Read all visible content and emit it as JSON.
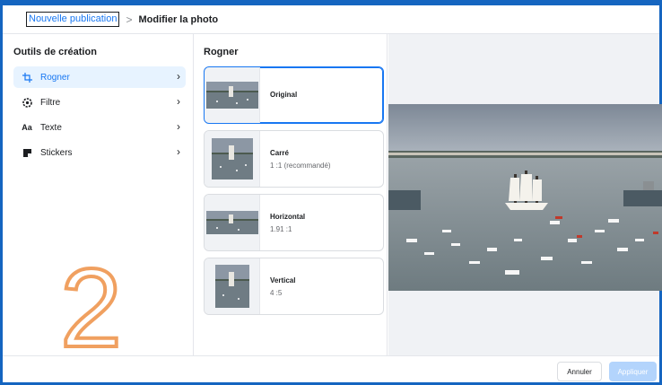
{
  "breadcrumb": {
    "parent": "Nouvelle publication",
    "separator": ">",
    "current": "Modifier la photo"
  },
  "sidebar": {
    "title": "Outils de création",
    "items": [
      {
        "label": "Rogner",
        "icon": "crop-icon",
        "active": true
      },
      {
        "label": "Filtre",
        "icon": "filter-icon",
        "active": false
      },
      {
        "label": "Texte",
        "icon": "text-icon",
        "active": false
      },
      {
        "label": "Stickers",
        "icon": "sticker-icon",
        "active": false
      }
    ],
    "chevron": "›"
  },
  "overlay_number": "2",
  "crop": {
    "title": "Rogner",
    "options": [
      {
        "title": "Original",
        "subtitle": "",
        "selected": true
      },
      {
        "title": "Carré",
        "subtitle": "1 :1 (recommandé)",
        "selected": false
      },
      {
        "title": "Horizontal",
        "subtitle": "1.91 :1",
        "selected": false
      },
      {
        "title": "Vertical",
        "subtitle": "4 :5",
        "selected": false
      }
    ]
  },
  "footer": {
    "cancel_label": "Annuler",
    "apply_label": "Appliquer"
  },
  "colors": {
    "accent": "#1877f2",
    "frame": "#1565c0",
    "overlay_number": "#f0a060",
    "apply_disabled": "#b3d4fc"
  }
}
